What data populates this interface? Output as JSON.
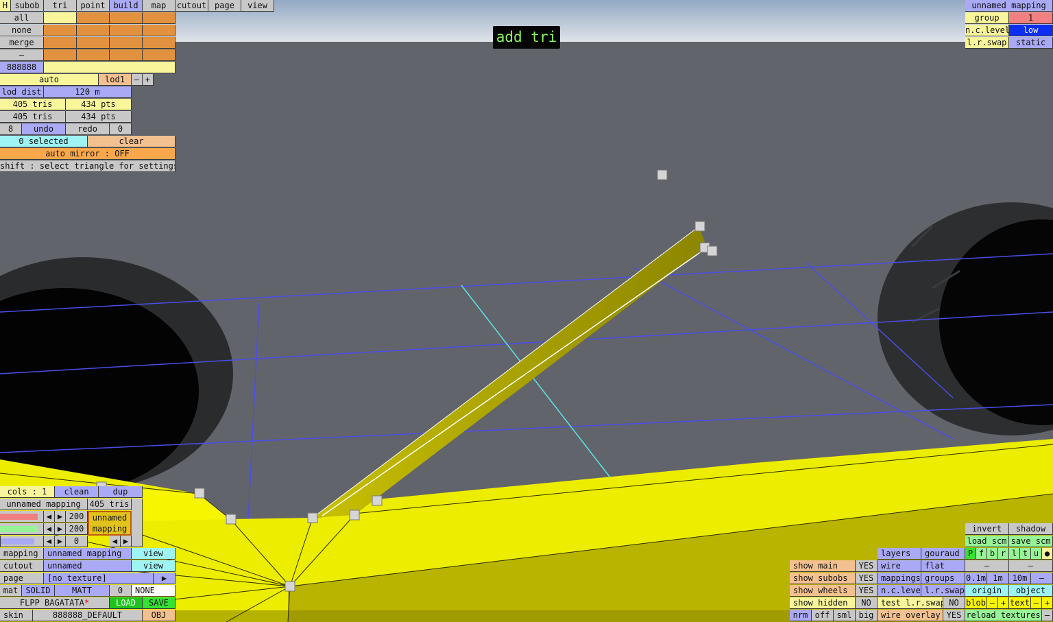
{
  "status": "add tri",
  "tabs": [
    "H",
    "subob",
    "tri",
    "point",
    "build",
    "map",
    "cutout",
    "page",
    "view"
  ],
  "subob_panel": {
    "all": "all",
    "none": "none",
    "merge": "merge",
    "minus": "–",
    "id": "888888"
  },
  "lod": {
    "auto": "auto",
    "level": "lod1",
    "minus": "–",
    "plus": "+",
    "dist_label": "lod dist",
    "dist_value": "120 m"
  },
  "stats": {
    "tris1": "405 tris",
    "pts1": "434 pts",
    "tris2": "405 tris",
    "pts2": "434 pts"
  },
  "history": {
    "undo_count": "8",
    "undo": "undo",
    "redo": "redo",
    "redo_count": "0"
  },
  "selection": {
    "selected": "0 selected",
    "clear": "clear",
    "mirror": "auto mirror : OFF",
    "hint": "shift : select triangle for settings"
  },
  "mapping_tr": {
    "name": "unnamed mapping",
    "group_label": "group",
    "group_value": "1",
    "nc_label": "n.c.level",
    "nc_value": "low",
    "lr_label": "l.r.swap",
    "lr_value": "static"
  },
  "bl_panel": {
    "cols": "cols : 1",
    "clean": "clean",
    "dup": "dup",
    "mapping_name": "unnamed mapping",
    "tris": "405 tris",
    "v1": "200",
    "v2": "200",
    "v3": "0",
    "preview_l1": "unnamed",
    "preview_l2": "mapping",
    "mapping_label": "mapping",
    "mapping_value": "unnamed mapping",
    "view1": "view",
    "cutout_label": "cutout",
    "cutout_value": "unnamed",
    "view2": "view",
    "page_label": "page",
    "page_value": "[no texture]",
    "arrow": "▶",
    "mat_label": "mat",
    "solid": "SOLID",
    "matt": "MATT",
    "mat_num": "0",
    "none": "NONE",
    "file_name": "FLPP BAGATATA",
    "star": "*",
    "load": "LOAD",
    "save": "SAVE",
    "skin_label": "skin",
    "skin_value": "888888_DEFAULT",
    "obj": "OBJ"
  },
  "br_show": {
    "main": "show main",
    "main_v": "YES",
    "subobs": "show subobs",
    "subobs_v": "YES",
    "wheels": "show wheels",
    "wheels_v": "YES",
    "hidden": "show hidden",
    "hidden_v": "NO",
    "nrm": "nrm",
    "off": "off",
    "sml": "sml",
    "big": "big"
  },
  "br_layers": {
    "layers": "layers",
    "gouraud": "gouraud",
    "wire": "wire",
    "flat": "flat",
    "mappings": "mappings",
    "groups": "groups",
    "nclevel": "n.c.level",
    "lrswap": "l.r.swap",
    "test": "test l.r.swap",
    "test_v": "NO",
    "overlay": "wire overlay",
    "overlay_v": "YES"
  },
  "br_tools": {
    "invert": "invert",
    "shadow": "shadow",
    "load_scm": "load scm",
    "save_scm": "save scm",
    "flags": [
      "P",
      "f",
      "b",
      "r",
      "l",
      "t",
      "u"
    ],
    "bullet": "●",
    "dash1": "–",
    "dash2": "–",
    "g1": "0.1m",
    "g2": "1m",
    "g3": "10m",
    "g_minus": "–",
    "origin": "origin",
    "object": "object",
    "blob": "blob",
    "blob_minus": "–",
    "blob_plus": "+",
    "text": "text",
    "text_minus": "–",
    "text_plus": "+",
    "reload": "reload textures",
    "reload_minus": "–"
  }
}
